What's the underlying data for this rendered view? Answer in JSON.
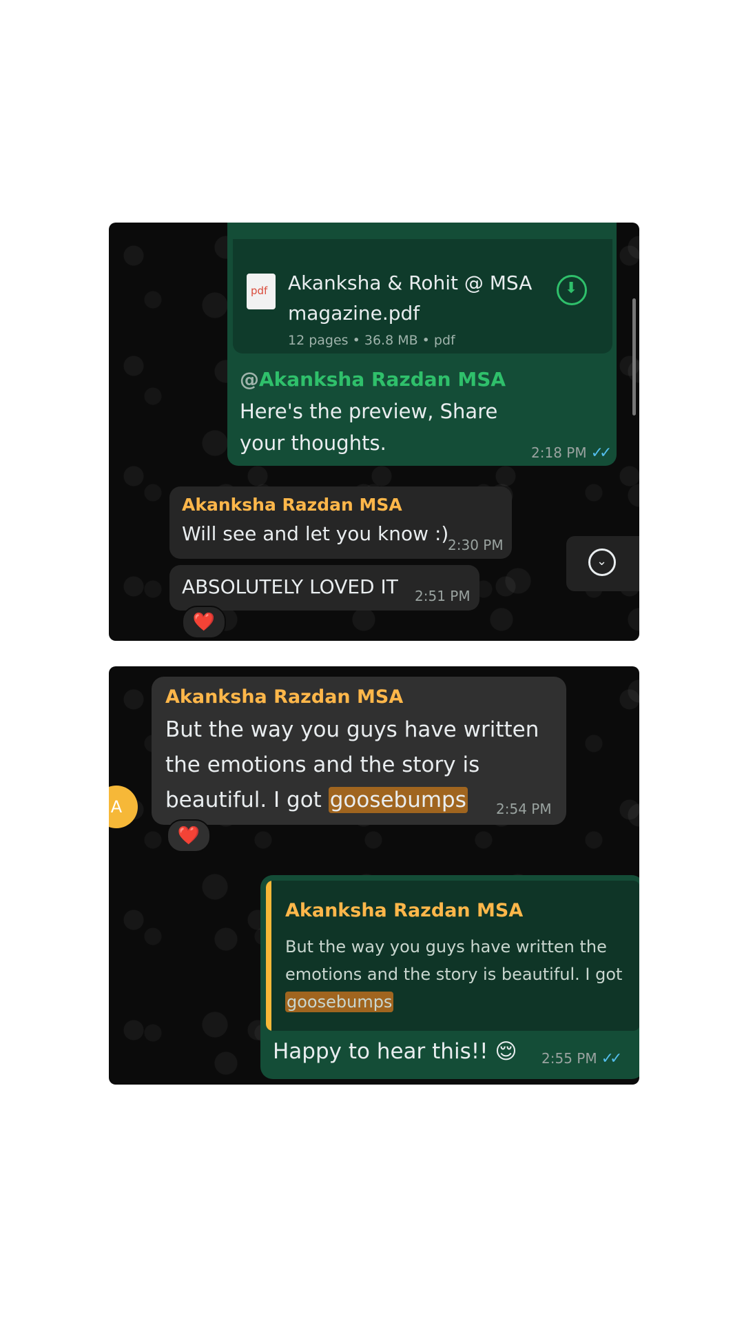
{
  "chat_top": {
    "pdf_message": {
      "file_name": "Akanksha & Rohit @ MSA magazine.pdf",
      "meta": "12 pages • 36.8 MB • pdf",
      "icon_label": "pdf",
      "mention": "@",
      "mention_name": "Akanksha Razdan MSA",
      "text": "Here's the preview, Share your thoughts.",
      "time": "2:18 PM"
    },
    "reply_1": {
      "sender": "Akanksha Razdan MSA",
      "text": "Will see and let you know :)",
      "time": "2:30 PM"
    },
    "reply_2": {
      "text": "ABSOLUTELY LOVED IT",
      "time": "2:51 PM",
      "reaction": "❤️"
    }
  },
  "chat_bottom": {
    "incoming": {
      "avatar_letter": "A",
      "sender": "Akanksha Razdan MSA",
      "text_before": "But the way you guys have written the emotions and the story is beautiful. I got",
      "highlight": "goosebumps",
      "time": "2:54 PM",
      "reaction": "❤️"
    },
    "outgoing": {
      "quoted_sender": "Akanksha Razdan MSA",
      "quoted_text": "But the way you guys have written the emotions and the story is beautiful. I got",
      "quoted_highlight": "goosebumps",
      "text": "Happy to hear this!! 😌",
      "time": "2:55 PM"
    }
  },
  "colors": {
    "outgoing_bubble": "#144d37",
    "incoming_bubble": "#262626",
    "sender_name": "#ffb74a",
    "mention": "#2fc06b",
    "read_ticks": "#53bdeb",
    "highlight": "#a0651f"
  },
  "icons": {
    "read_receipt": "double-check-icon",
    "download": "download-icon",
    "scroll_down": "chevron-down-icon"
  }
}
